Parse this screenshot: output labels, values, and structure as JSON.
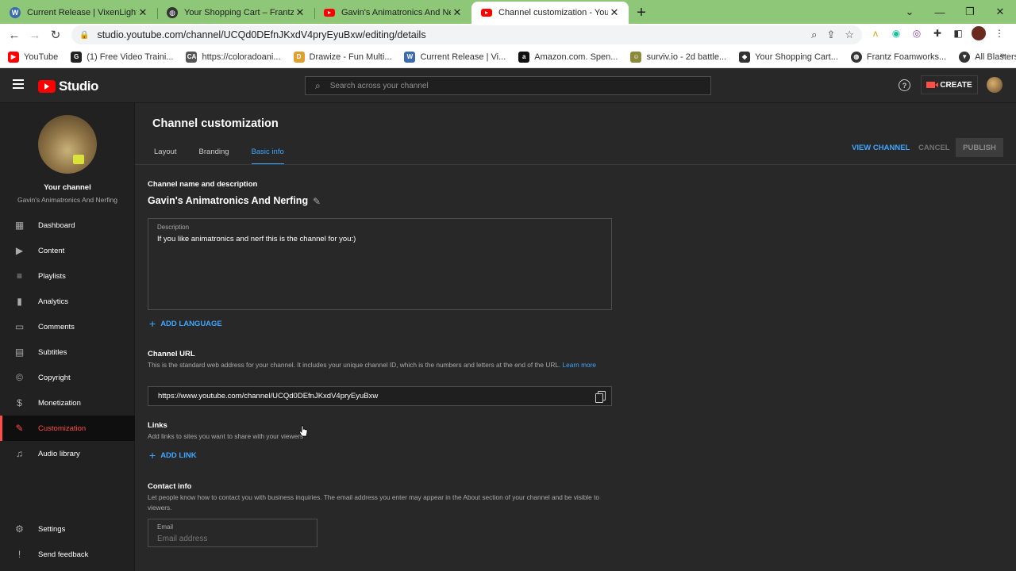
{
  "browser": {
    "tabs": [
      {
        "title": "Current Release | VixenLights",
        "icon": "wordpress-icon"
      },
      {
        "title": "Your Shopping Cart – Frantz Foamworks",
        "icon": "globe-icon"
      },
      {
        "title": "Gavin's Animatronics And Nerfing",
        "icon": "youtube-icon"
      },
      {
        "title": "Channel customization - YouTube Studio",
        "icon": "youtube-icon"
      }
    ],
    "url": "studio.youtube.com/channel/UCQd0DEfnJKxdV4pryEyuBxw/editing/details",
    "bookmarks": [
      {
        "label": "YouTube",
        "color": "#ff0000"
      },
      {
        "label": "(1) Free Video Traini...",
        "color": "#222222"
      },
      {
        "label": "https://coloradoani...",
        "color": "#555555"
      },
      {
        "label": "Drawize - Fun Multi...",
        "color": "#e0a030"
      },
      {
        "label": "Current Release | Vi...",
        "color": "#3d6bb0"
      },
      {
        "label": "Amazon.com. Spen...",
        "color": "#111111"
      },
      {
        "label": "surviv.io - 2d battle...",
        "color": "#8a8a3a"
      },
      {
        "label": "Your Shopping Cart...",
        "color": "#333333"
      },
      {
        "label": "Frantz Foamworks...",
        "color": "#333333"
      },
      {
        "label": "All Blasters – SilverF...",
        "color": "#333333"
      }
    ],
    "bookmarks_more": "»"
  },
  "studio": {
    "logo_text": "Studio",
    "search_placeholder": "Search across your channel",
    "help_glyph": "?",
    "create_label": "CREATE"
  },
  "sidebar": {
    "your_channel": "Your channel",
    "channel_name": "Gavin's Animatronics And Nerfing",
    "items": [
      {
        "label": "Dashboard",
        "icon": "▦"
      },
      {
        "label": "Content",
        "icon": "▶"
      },
      {
        "label": "Playlists",
        "icon": "≡"
      },
      {
        "label": "Analytics",
        "icon": "▮"
      },
      {
        "label": "Comments",
        "icon": "▭"
      },
      {
        "label": "Subtitles",
        "icon": "▤"
      },
      {
        "label": "Copyright",
        "icon": "©"
      },
      {
        "label": "Monetization",
        "icon": "$"
      },
      {
        "label": "Customization",
        "icon": "✎"
      },
      {
        "label": "Audio library",
        "icon": "♫"
      }
    ],
    "settings": {
      "label": "Settings",
      "icon": "⚙"
    },
    "feedback": {
      "label": "Send feedback",
      "icon": "!"
    }
  },
  "main": {
    "title": "Channel customization",
    "tabs": [
      "Layout",
      "Branding",
      "Basic info"
    ],
    "view_channel": "VIEW CHANNEL",
    "cancel": "CANCEL",
    "publish": "PUBLISH",
    "name_section": {
      "heading": "Channel name and description",
      "channel_title": "Gavin's Animatronics And Nerfing",
      "description_label": "Description",
      "description_value": "If you like animatronics and nerf this is the channel for you:)"
    },
    "add_language": "ADD LANGUAGE",
    "url_section": {
      "heading": "Channel URL",
      "desc": "This is the standard web address for your channel. It includes your unique channel ID, which is the numbers and letters at the end of the URL.",
      "learn_more": "Learn more",
      "url": "https://www.youtube.com/channel/UCQd0DEfnJKxdV4pryEyuBxw"
    },
    "links_section": {
      "heading": "Links",
      "desc": "Add links to sites you want to share with your viewers",
      "add_link": "ADD LINK"
    },
    "contact_section": {
      "heading": "Contact info",
      "desc": "Let people know how to contact you with business inquiries. The email address you enter may appear in the About section of your channel and be visible to viewers.",
      "email_label": "Email",
      "email_placeholder": "Email address"
    }
  }
}
